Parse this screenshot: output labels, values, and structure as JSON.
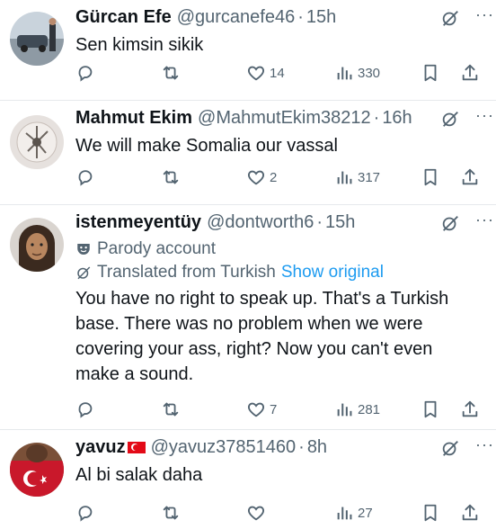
{
  "tweets": [
    {
      "name": "Gürcan Efe",
      "handle": "@gurcanefe46",
      "time": "15h",
      "text": "Sen kimsin sikik",
      "replies": "",
      "retweets": "",
      "likes": "14",
      "views": "330"
    },
    {
      "name": "Mahmut Ekim",
      "handle": "@MahmutEkim38212",
      "time": "16h",
      "text": "We will make Somalia our vassal",
      "replies": "",
      "retweets": "",
      "likes": "2",
      "views": "317"
    },
    {
      "name": "istenmeyentüy",
      "handle": "@dontworth6",
      "time": "15h",
      "parody_label": "Parody account",
      "translated_label": "Translated from Turkish",
      "show_original": "Show original",
      "text_lines": [
        "You have no right to speak up. That's a Turkish",
        "base. There was no problem when we were",
        "covering your ass, right? Now you can't even",
        "make a sound."
      ],
      "replies": "",
      "retweets": "",
      "likes": "7",
      "views": "281"
    },
    {
      "name": "yavuz",
      "handle": "@yavuz37851460",
      "time": "8h",
      "text": "Al bi salak daha",
      "replies": "",
      "retweets": "",
      "likes": "",
      "views": "27"
    }
  ],
  "ui": {
    "separator": "·",
    "more": "···"
  },
  "colors": {
    "text": "#0f1419",
    "secondary": "#536471",
    "link": "#1d9bf0",
    "divider": "#e6e9ec",
    "flag_red": "#e30a17"
  },
  "icons": [
    "reply-icon",
    "retweet-icon",
    "like-icon",
    "views-icon",
    "bookmark-icon",
    "share-icon",
    "grok-icon",
    "more-icon",
    "parody-mask-icon",
    "translate-icon",
    "turkey-flag-icon"
  ]
}
